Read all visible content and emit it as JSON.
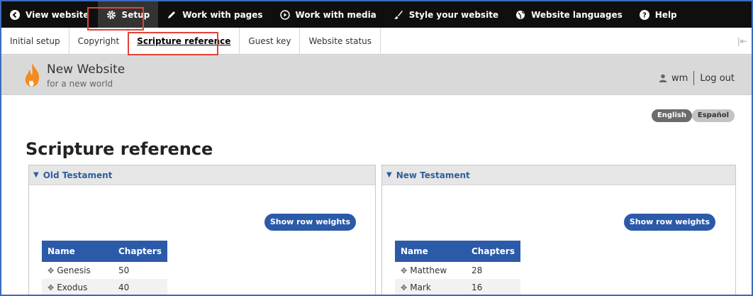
{
  "toolbar": {
    "items": [
      {
        "label": "View website",
        "icon": "chevron-left-circle-icon"
      },
      {
        "label": "Setup",
        "icon": "gear-icon"
      },
      {
        "label": "Work with pages",
        "icon": "pencil-icon"
      },
      {
        "label": "Work with media",
        "icon": "play-circle-icon"
      },
      {
        "label": "Style your website",
        "icon": "brush-icon"
      },
      {
        "label": "Website languages",
        "icon": "globe-icon"
      },
      {
        "label": "Help",
        "icon": "question-circle-icon"
      }
    ]
  },
  "tray": {
    "tabs": [
      {
        "label": "Initial setup"
      },
      {
        "label": "Copyright"
      },
      {
        "label": "Scripture reference"
      },
      {
        "label": "Guest key"
      },
      {
        "label": "Website status"
      }
    ],
    "collapse_icon": "|⇤"
  },
  "header": {
    "site_name": "New Website",
    "slogan": "for a new world",
    "username": "wm",
    "logout": "Log out"
  },
  "languages": {
    "english": "English",
    "spanish": "Español"
  },
  "page": {
    "title": "Scripture reference"
  },
  "panels": {
    "old": {
      "title": "Old Testament",
      "button": "Show row weights",
      "col_name": "Name",
      "col_chapters": "Chapters",
      "rows": [
        {
          "name": "Genesis",
          "chapters": "50"
        },
        {
          "name": "Exodus",
          "chapters": "40"
        }
      ]
    },
    "new": {
      "title": "New Testament",
      "button": "Show row weights",
      "col_name": "Name",
      "col_chapters": "Chapters",
      "rows": [
        {
          "name": "Matthew",
          "chapters": "28"
        },
        {
          "name": "Mark",
          "chapters": "16"
        }
      ]
    }
  },
  "colors": {
    "accent": "#2b5aa8",
    "highlight": "#e2433a",
    "toolbar_bg": "#0f0f0f"
  }
}
